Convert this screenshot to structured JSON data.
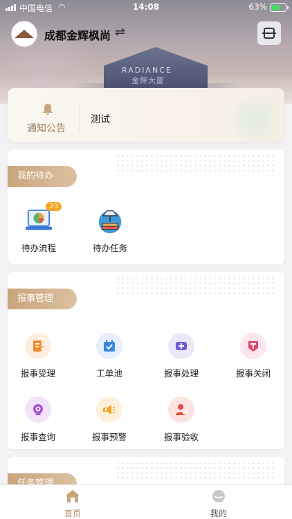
{
  "status_bar": {
    "carrier": "中国电信",
    "time": "14:08",
    "battery": "63%"
  },
  "header": {
    "project_name": "成都金辉枫尚",
    "building_text": "RADIANCE",
    "building_text2": "金辉大厦"
  },
  "notice": {
    "label": "通知公告",
    "text": "测试"
  },
  "todo_section": {
    "title": "我的待办",
    "items": [
      {
        "label": "待办流程",
        "badge": "23"
      },
      {
        "label": "待办任务"
      }
    ]
  },
  "report_section": {
    "title": "报事管理",
    "items": [
      {
        "label": "报事受理"
      },
      {
        "label": "工单池"
      },
      {
        "label": "报事处理"
      },
      {
        "label": "报事关闭"
      },
      {
        "label": "报事查询"
      },
      {
        "label": "报事预警"
      },
      {
        "label": "报事验收"
      }
    ]
  },
  "task_section": {
    "title": "任务管理"
  },
  "tabbar": {
    "home": "首页",
    "mine": "我的"
  },
  "colors": {
    "accent": "#c9a57c",
    "active_tab": "#b08b62"
  }
}
